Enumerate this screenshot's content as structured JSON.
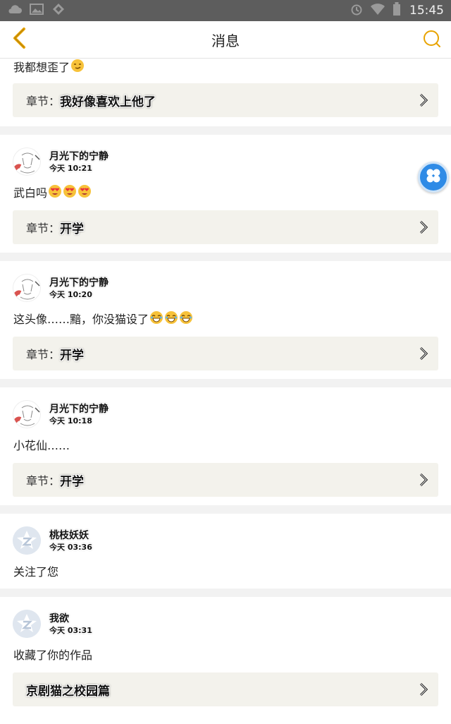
{
  "status_bar": {
    "time": "15:45",
    "left_icons": [
      "cloud-icon",
      "image-icon",
      "game-icon"
    ],
    "right_icons": [
      "alarm-icon",
      "wifi-icon",
      "battery-icon"
    ]
  },
  "header": {
    "title": "消息",
    "back_icon": "chevron-left-icon",
    "search_icon": "search-icon",
    "accent": "#e8a300"
  },
  "messages": [
    {
      "text": "我都想歪了",
      "emojis": [
        "smirk"
      ],
      "chapter_label": "章节：",
      "chapter_title": "我好像喜欢上他了"
    },
    {
      "user": "月光下的宁静",
      "time": "今天 10:21",
      "avatar": "sketch",
      "text": "武白吗",
      "emojis": [
        "heart-eyes",
        "heart-eyes",
        "heart-eyes"
      ],
      "chapter_label": "章节：",
      "chapter_title": "开学"
    },
    {
      "user": "月光下的宁静",
      "time": "今天 10:20",
      "avatar": "sketch",
      "text": "这头像……黯，你没猫设了",
      "emojis": [
        "laugh",
        "laugh",
        "laugh"
      ],
      "chapter_label": "章节：",
      "chapter_title": "开学"
    },
    {
      "user": "月光下的宁静",
      "time": "今天 10:18",
      "avatar": "sketch",
      "text": "小花仙……",
      "emojis": [],
      "chapter_label": "章节：",
      "chapter_title": "开学"
    },
    {
      "user": "桃枝妖妖",
      "time": "今天 03:36",
      "avatar": "default",
      "text": "关注了您",
      "emojis": []
    },
    {
      "user": "我欲",
      "time": "今天 03:31",
      "avatar": "default",
      "text": "收藏了你的作品",
      "emojis": [],
      "chapter_label": "",
      "chapter_title": "京剧猫之校园篇"
    }
  ],
  "floating_button": {
    "icon": "four-petal-icon",
    "color": "#2f8be6"
  }
}
